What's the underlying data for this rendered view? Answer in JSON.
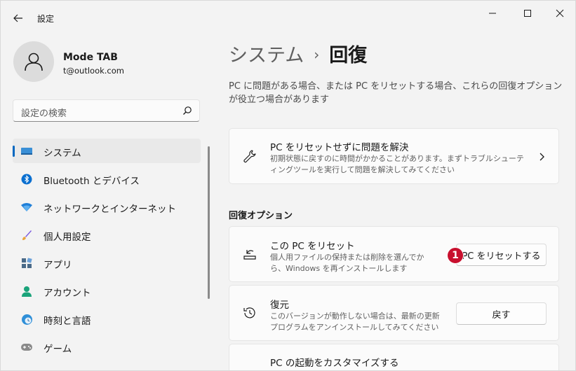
{
  "window": {
    "title": "設定"
  },
  "user": {
    "name": "Mode TAB",
    "email": "t@outlook.com"
  },
  "search": {
    "placeholder": "設定の検索"
  },
  "nav": {
    "items": [
      {
        "label": "システム",
        "icon": "system-display-icon",
        "active": true
      },
      {
        "label": "Bluetooth とデバイス",
        "icon": "bluetooth-icon"
      },
      {
        "label": "ネットワークとインターネット",
        "icon": "wifi-icon"
      },
      {
        "label": "個人用設定",
        "icon": "brush-icon"
      },
      {
        "label": "アプリ",
        "icon": "apps-icon"
      },
      {
        "label": "アカウント",
        "icon": "account-icon"
      },
      {
        "label": "時刻と言語",
        "icon": "time-language-icon"
      },
      {
        "label": "ゲーム",
        "icon": "gamepad-icon"
      }
    ]
  },
  "main": {
    "breadcrumb_parent": "システム",
    "breadcrumb_sep": "›",
    "breadcrumb_current": "回復",
    "description": "PC に問題がある場合、または PC をリセットする場合、これらの回復オプションが役立つ場合があります",
    "troubleshoot": {
      "title": "PC をリセットせずに問題を解決",
      "subtitle": "初期状態に戻すのに時間がかかることがあります。まずトラブルシューティングツールを実行して問題を解決してみてください"
    },
    "section_title": "回復オプション",
    "reset": {
      "title": "この PC をリセット",
      "subtitle": "個人用ファイルの保持または削除を選んでから、Windows を再インストールします",
      "button": "PC をリセットする",
      "badge": "1"
    },
    "goback": {
      "title": "復元",
      "subtitle": "このバージョンが動作しない場合は、最新の更新プログラムをアンインストールしてみてください",
      "button": "戻す"
    },
    "startup": {
      "title": "PC の起動をカスタマイズする"
    }
  },
  "colors": {
    "accent": "#0067c0",
    "badge": "#c8102e"
  }
}
